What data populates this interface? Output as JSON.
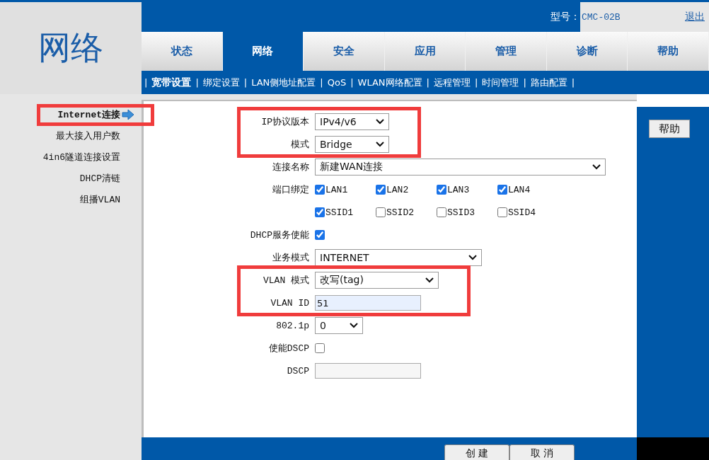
{
  "logo": {
    "title": "网络"
  },
  "header": {
    "model_label": "型号：",
    "model_value": "CMC-02B",
    "logout": "退出"
  },
  "tabs": [
    {
      "label": "状态",
      "selected": false
    },
    {
      "label": "网络",
      "selected": true
    },
    {
      "label": "安全",
      "selected": false
    },
    {
      "label": "应用",
      "selected": false
    },
    {
      "label": "管理",
      "selected": false
    },
    {
      "label": "诊断",
      "selected": false
    },
    {
      "label": "帮助",
      "selected": false
    }
  ],
  "submenu": {
    "separator": "|",
    "items": [
      {
        "label": "宽带设置",
        "selected": true
      },
      {
        "label": "绑定设置",
        "selected": false
      },
      {
        "label": "LAN侧地址配置",
        "selected": false
      },
      {
        "label": "QoS",
        "selected": false
      },
      {
        "label": "WLAN网络配置",
        "selected": false
      },
      {
        "label": "远程管理",
        "selected": false
      },
      {
        "label": "时间管理",
        "selected": false
      },
      {
        "label": "路由配置",
        "selected": false
      }
    ]
  },
  "sidebar": {
    "items": [
      {
        "label": "Internet连接",
        "selected": true,
        "highlighted": true
      },
      {
        "label": "最大接入用户数",
        "selected": false,
        "highlighted": false
      },
      {
        "label": "4in6隧道连接设置",
        "selected": false,
        "highlighted": false
      },
      {
        "label": "DHCP清链",
        "selected": false,
        "highlighted": false
      },
      {
        "label": "组播VLAN",
        "selected": false,
        "highlighted": false
      }
    ]
  },
  "form": {
    "rows": [
      {
        "kind": "select",
        "label": "IP协议版本",
        "value": "IPv4/v6",
        "highlighted": true
      },
      {
        "kind": "select",
        "label": "模式",
        "value": "Bridge",
        "highlighted": true
      },
      {
        "kind": "select",
        "label": "连接名称",
        "value": "新建WAN连接",
        "highlighted": false
      },
      {
        "kind": "checkboxes",
        "label": "端口绑定",
        "options": [
          {
            "label": "LAN1",
            "checked": true
          },
          {
            "label": "LAN2",
            "checked": true
          },
          {
            "label": "LAN3",
            "checked": true
          },
          {
            "label": "LAN4",
            "checked": true
          }
        ],
        "highlighted": false
      },
      {
        "kind": "checkboxes",
        "options": [
          {
            "label": "SSID1",
            "checked": true
          },
          {
            "label": "SSID2",
            "checked": false
          },
          {
            "label": "SSID3",
            "checked": false
          },
          {
            "label": "SSID4",
            "checked": false
          }
        ],
        "highlighted": false
      },
      {
        "kind": "checkbox",
        "label": "DHCP服务使能",
        "checked": true,
        "highlighted": false
      },
      {
        "kind": "select",
        "label": "业务模式",
        "value": "INTERNET",
        "highlighted": false
      },
      {
        "kind": "select",
        "label": "VLAN 模式",
        "value": "改写(tag)",
        "highlighted": true
      },
      {
        "kind": "input",
        "label": "VLAN ID",
        "value": "51",
        "disabled": false,
        "highlighted": true
      },
      {
        "kind": "select",
        "label": "802.1p",
        "value": "0",
        "highlighted": false
      },
      {
        "kind": "checkbox",
        "label": "使能DSCP",
        "checked": false,
        "highlighted": false
      },
      {
        "kind": "input",
        "label": "DSCP",
        "disabled": true,
        "highlighted": false
      }
    ]
  },
  "help_button": "帮助",
  "buttons": [
    "创 建",
    "取 消"
  ]
}
